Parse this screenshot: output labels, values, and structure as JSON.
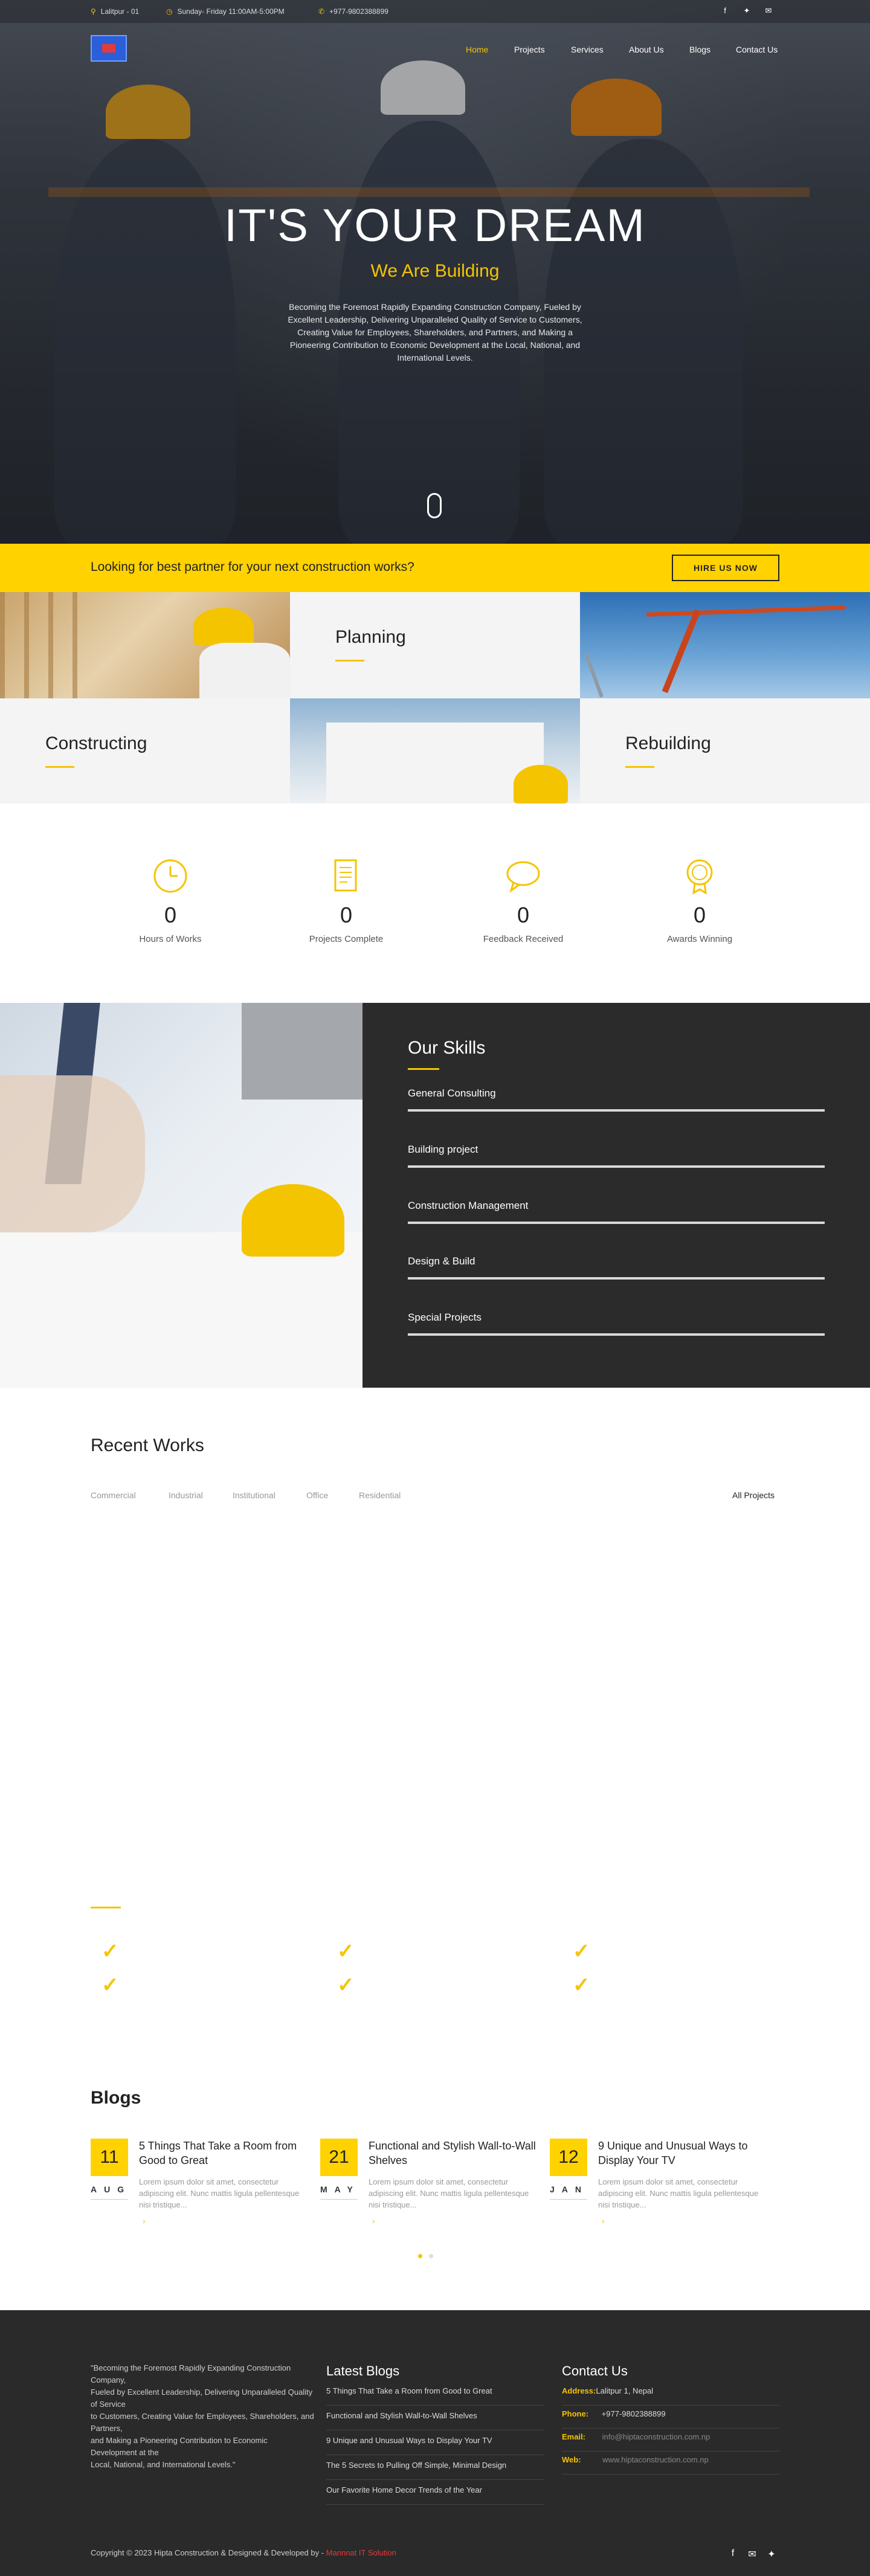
{
  "topbar": {
    "location": "Lalitpur - 01",
    "hours": "Sunday- Friday 11:00AM-5:00PM",
    "phone": "+977-9802388899"
  },
  "icons": {
    "location": "map-marker-icon",
    "hours": "clock-icon",
    "phone": "phone-icon",
    "facebook": "facebook-icon",
    "twitter": "twitter-icon",
    "email": "envelope-icon"
  },
  "nav": {
    "items": [
      "Home",
      "Projects",
      "Services",
      "About Us",
      "Blogs",
      "Contact Us"
    ],
    "active": "Home"
  },
  "hero": {
    "title": "IT'S YOUR DREAM",
    "subtitle": "We Are Building",
    "description": "Becoming the Foremost Rapidly Expanding Construction Company, Fueled by Excellent Leadership, Delivering Unparalleled Quality of Service to Customers, Creating Value for Employees, Shareholders, and Partners, and Making a Pioneering Contribution to Economic Development at the Local, National, and International Levels."
  },
  "cta": {
    "text": "Looking for best partner for your next construction works?",
    "button": "HIRE US NOW"
  },
  "services": [
    "Planning",
    "Constructing",
    "Rebuilding"
  ],
  "counters": [
    {
      "value": "0",
      "label": "Hours of Works",
      "icon": "clock-icon"
    },
    {
      "value": "0",
      "label": "Projects Complete",
      "icon": "document-icon"
    },
    {
      "value": "0",
      "label": "Feedback Received",
      "icon": "chat-bubble-icon"
    },
    {
      "value": "0",
      "label": "Awards Winning",
      "icon": "award-icon"
    }
  ],
  "skills": {
    "title": "Our Skills",
    "items": [
      {
        "label": "General Consulting",
        "level": 1.0
      },
      {
        "label": "Building project",
        "level": 1.0
      },
      {
        "label": "Construction Management",
        "level": 1.0
      },
      {
        "label": "Design & Build",
        "level": 1.0
      },
      {
        "label": "Special Projects",
        "level": 1.0
      }
    ]
  },
  "recent_works": {
    "title": "Recent Works",
    "filters": [
      "Commercial",
      "Industrial",
      "Institutional",
      "Office",
      "Residential"
    ],
    "all_label": "All Projects"
  },
  "blogs": {
    "title": "Blogs",
    "items": [
      {
        "day": "11",
        "month": "AUG",
        "title": "5 Things That Take a Room from Good to Great",
        "excerpt": "Lorem ipsum dolor sit amet, consectetur adipiscing elit. Nunc mattis ligula pellentesque nisi tristique..."
      },
      {
        "day": "21",
        "month": "MAY",
        "title": "Functional and Stylish Wall-to-Wall Shelves",
        "excerpt": "Lorem ipsum dolor sit amet, consectetur adipiscing elit. Nunc mattis ligula pellentesque nisi tristique..."
      },
      {
        "day": "12",
        "month": "JAN",
        "title": "9 Unique and Unusual Ways to Display Your TV",
        "excerpt": "Lorem ipsum dolor sit amet, consectetur adipiscing elit. Nunc mattis ligula pellentesque nisi tristique..."
      }
    ],
    "arrow": "›"
  },
  "footer": {
    "about": "\"Becoming the Foremost Rapidly Expanding Construction Company,\nFueled by Excellent Leadership, Delivering Unparalleled Quality of Service\nto Customers, Creating Value for Employees, Shareholders, and Partners,\nand Making a Pioneering Contribution to Economic Development at the\nLocal, National, and International Levels.\"",
    "latest_title": "Latest Blogs",
    "latest": [
      "5 Things That Take a Room from Good to Great",
      "Functional and Stylish Wall-to-Wall Shelves",
      "9 Unique and Unusual Ways to Display Your TV",
      "The 5 Secrets to Pulling Off Simple, Minimal Design",
      "Our Favorite Home Decor Trends of the Year"
    ],
    "contact_title": "Contact Us",
    "contact": [
      {
        "key": "Address:",
        "value": "Lalitpur 1, Nepal"
      },
      {
        "key": "Phone:",
        "value": "+977-9802388899"
      },
      {
        "key": "Email:",
        "value": "info@hiptaconstruction.com.np"
      },
      {
        "key": "Web:",
        "value": "www.hiptaconstruction.com.np"
      }
    ],
    "copyright": "Copyright © 2023 Hipta Construction & Designed & Developed by - ",
    "developer": "Mannnat IT Solution"
  },
  "colors": {
    "accent": "#ffd200",
    "dark": "#2b2b2b"
  }
}
